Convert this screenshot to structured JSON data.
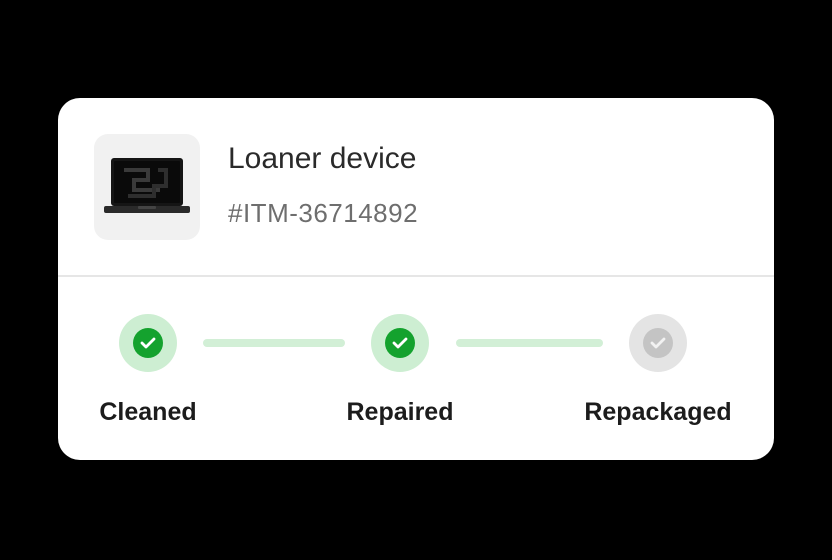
{
  "item": {
    "title": "Loaner device",
    "id": "#ITM-36714892",
    "thumbnail_icon": "laptop-icon"
  },
  "progress": {
    "steps": [
      {
        "label": "Cleaned",
        "status": "complete",
        "icon": "check-icon"
      },
      {
        "label": "Repaired",
        "status": "complete",
        "icon": "check-icon"
      },
      {
        "label": "Repackaged",
        "status": "pending",
        "icon": "check-icon"
      }
    ]
  },
  "colors": {
    "complete": "#14a22e",
    "complete_ring": "#cdeed2",
    "pending": "#c4c4c4",
    "pending_ring": "#e4e4e4",
    "connector": "#d2efd6"
  }
}
